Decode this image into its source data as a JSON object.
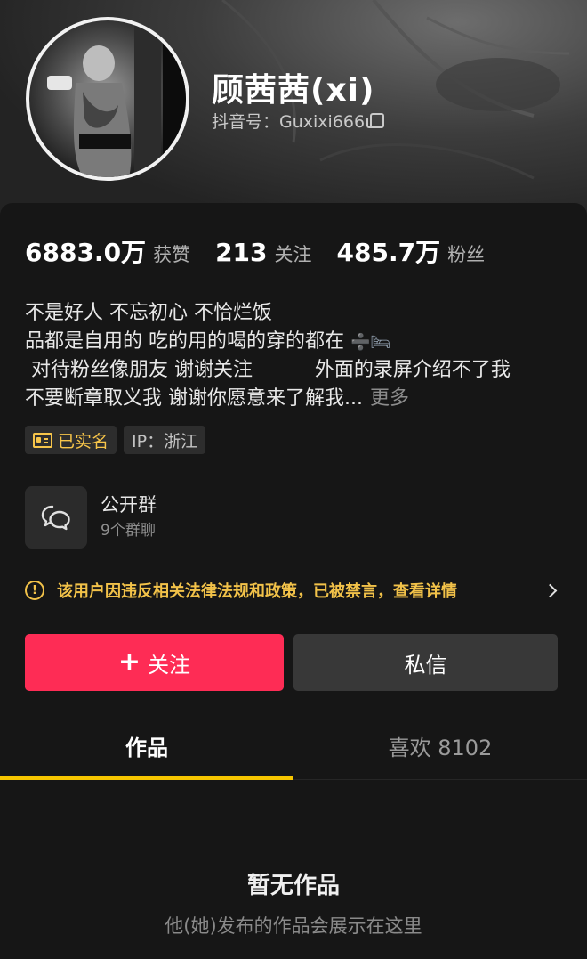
{
  "profile": {
    "nickname": "顾茜茜(xi)",
    "douyin_id": "抖音号：Guxixi666"
  },
  "stats": [
    {
      "value": "6883.0万",
      "label": "获赞"
    },
    {
      "value": "213",
      "label": "关注"
    },
    {
      "value": "485.7万",
      "label": "粉丝"
    }
  ],
  "bio": {
    "lines": [
      "不是好人 不忘初心 不恰烂饭",
      "品都是自用的 吃的用的喝的穿的都在 ",
      " 对待粉丝像朋友 谢谢关注          外面的录屏介绍不了我",
      "不要断章取义我 谢谢你愿意来了解我..."
    ],
    "bed_emoji": "➗🛏",
    "more": "更多"
  },
  "tags": {
    "verified": "已实名",
    "ip": "IP：浙江"
  },
  "group": {
    "title": "公开群",
    "subtitle": "9个群聊"
  },
  "warning": {
    "text": "该用户因违反相关法律法规和政策，已被禁言，查看详情"
  },
  "actions": {
    "follow_label": "关注",
    "follow_plus": "+",
    "message_label": "私信"
  },
  "tabs": {
    "works": "作品",
    "likes": "喜欢 8102"
  },
  "empty": {
    "title": "暂无作品",
    "subtitle": "他(她)发布的作品会展示在这里"
  },
  "colors": {
    "accent_red": "#fe2c55",
    "warning_yellow": "#f2c249",
    "tab_underline": "#f7c600"
  },
  "icons": {
    "copy": "copy-icon",
    "id_card": "id-card-icon",
    "group_chat": "chat-bubbles-icon",
    "warning": "exclamation-circle-icon",
    "chevron": "chevron-right-icon"
  }
}
